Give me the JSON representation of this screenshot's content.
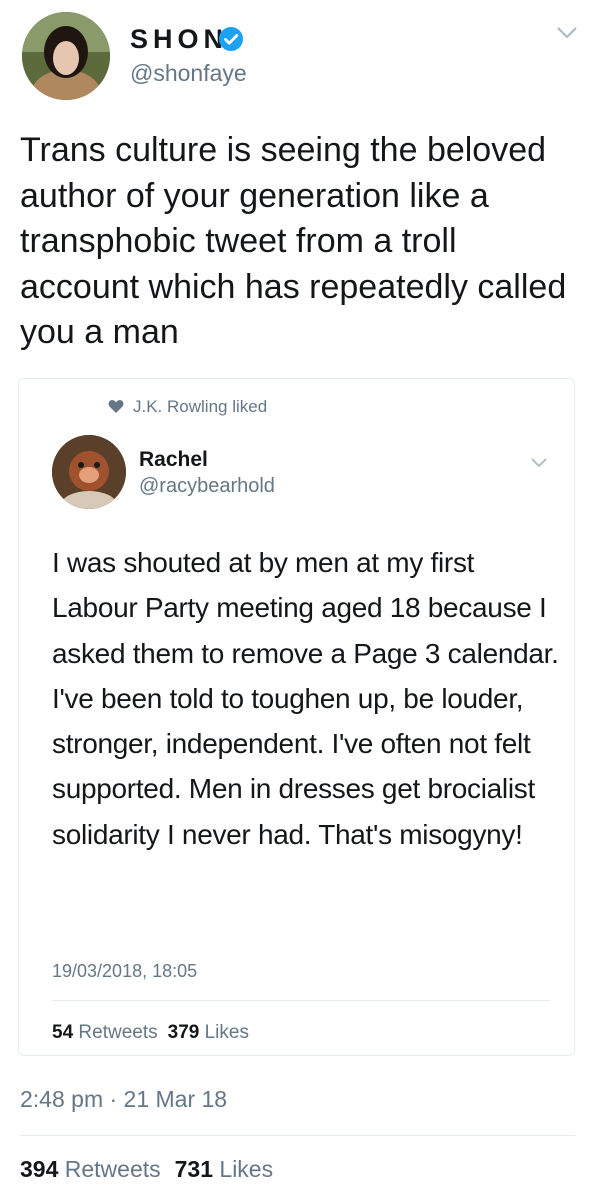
{
  "tweet": {
    "display_name": "SHON",
    "handle": "@shonfaye",
    "verified_icon": "verified-badge-icon",
    "text": "Trans culture is seeing the beloved author of your generation like a transphobic tweet from a troll account which has repeatedly called you a man",
    "timestamp": "2:48 pm · 21 Mar 18",
    "retweets_count": "394",
    "retweets_label": "Retweets",
    "likes_count": "731",
    "likes_label": "Likes"
  },
  "quoted": {
    "context": "J.K. Rowling liked",
    "display_name": "Rachel",
    "handle": "@racybearhold",
    "text": "I was shouted at by men at my first Labour Party meeting aged 18 because I asked them to remove a Page 3 calendar. I've been told to toughen up, be louder, stronger, independent. I've often not felt supported. Men in dresses get brocialist solidarity I never had. That's misogyny!",
    "timestamp": "19/03/2018, 18:05",
    "retweets_count": "54",
    "retweets_label": "Retweets",
    "likes_count": "379",
    "likes_label": "Likes"
  },
  "colors": {
    "text": "#14171a",
    "secondary": "#657786",
    "verified": "#1da1f2",
    "border": "#e6ecf0"
  }
}
